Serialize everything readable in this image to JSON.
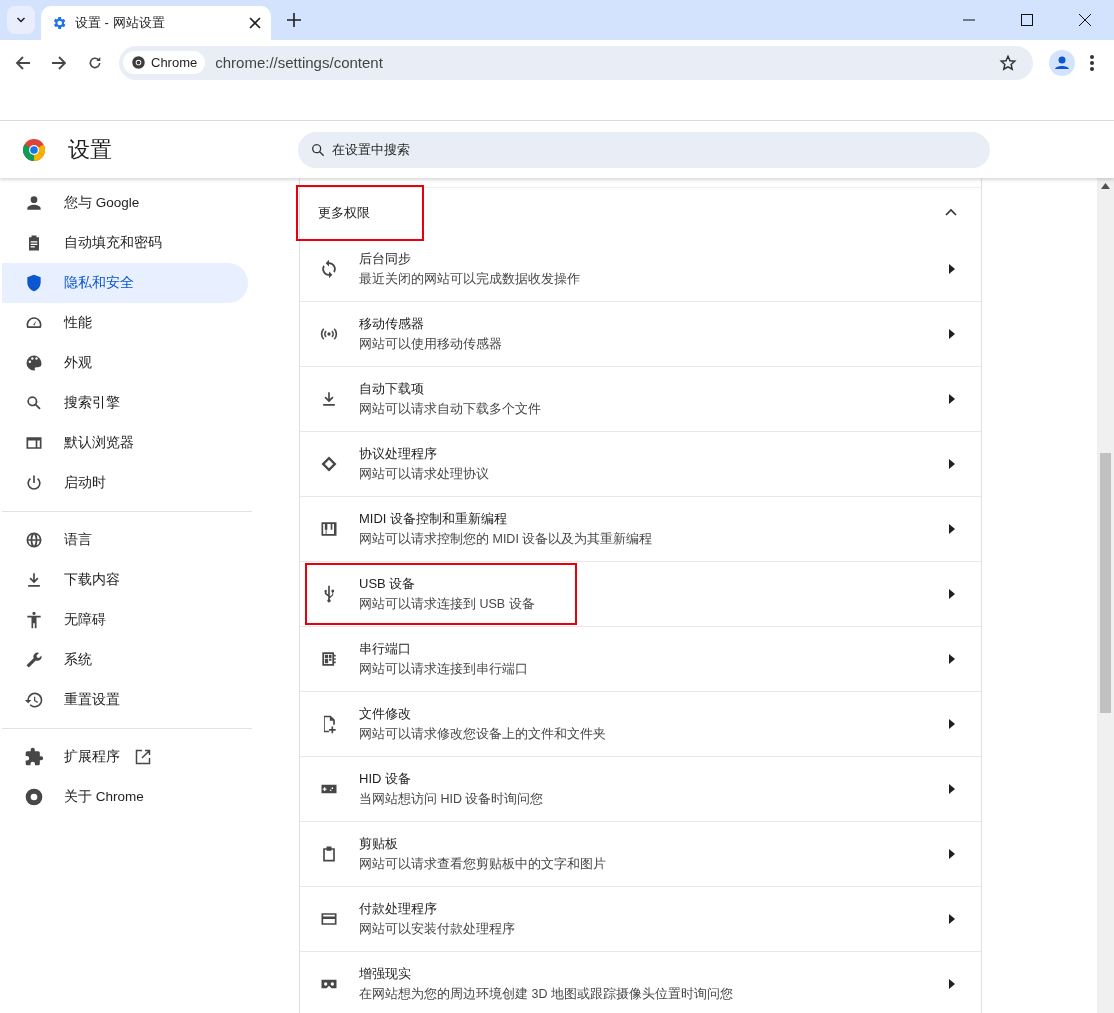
{
  "tab": {
    "title": "设置 - 网站设置",
    "selected": true
  },
  "address_bar": {
    "chip": "Chrome",
    "url": "chrome://settings/content"
  },
  "header": {
    "title": "设置",
    "search": {
      "placeholder": "在设置中搜索"
    }
  },
  "sidebar": {
    "groups": [
      [
        {
          "label": "您与 Google",
          "selected": false
        },
        {
          "label": "自动填充和密码",
          "selected": false
        },
        {
          "label": "隐私和安全",
          "selected": true
        },
        {
          "label": "性能",
          "selected": false
        },
        {
          "label": "外观",
          "selected": false
        },
        {
          "label": "搜索引擎",
          "selected": false
        },
        {
          "label": "默认浏览器",
          "selected": false
        },
        {
          "label": "启动时",
          "selected": false
        }
      ],
      [
        {
          "label": "语言",
          "selected": false
        },
        {
          "label": "下载内容",
          "selected": false
        },
        {
          "label": "无障碍",
          "selected": false
        },
        {
          "label": "系统",
          "selected": false
        },
        {
          "label": "重置设置",
          "selected": false
        }
      ],
      [
        {
          "label": "扩展程序",
          "selected": false,
          "external": true
        },
        {
          "label": "关于 Chrome",
          "selected": false,
          "external": false
        }
      ]
    ]
  },
  "section": {
    "title": "更多权限",
    "expanded": true,
    "highlighted": true
  },
  "permissions": [
    {
      "title": "后台同步",
      "description": "最近关闭的网站可以完成数据收发操作",
      "highlighted": false
    },
    {
      "title": "移动传感器",
      "description": "网站可以使用移动传感器",
      "highlighted": false
    },
    {
      "title": "自动下载项",
      "description": "网站可以请求自动下载多个文件",
      "highlighted": false
    },
    {
      "title": "协议处理程序",
      "description": "网站可以请求处理协议",
      "highlighted": false
    },
    {
      "title": "MIDI 设备控制和重新编程",
      "description": "网站可以请求控制您的 MIDI 设备以及为其重新编程",
      "highlighted": false
    },
    {
      "title": "USB 设备",
      "description": "网站可以请求连接到 USB 设备",
      "highlighted": true
    },
    {
      "title": "串行端口",
      "description": "网站可以请求连接到串行端口",
      "highlighted": false
    },
    {
      "title": "文件修改",
      "description": "网站可以请求修改您设备上的文件和文件夹",
      "highlighted": false
    },
    {
      "title": "HID 设备",
      "description": "当网站想访问 HID 设备时询问您",
      "highlighted": false
    },
    {
      "title": "剪贴板",
      "description": "网站可以请求查看您剪贴板中的文字和图片",
      "highlighted": false
    },
    {
      "title": "付款处理程序",
      "description": "网站可以安装付款处理程序",
      "highlighted": false
    },
    {
      "title": "增强现实",
      "description": "在网站想为您的周边环境创建 3D 地图或跟踪摄像头位置时询问您",
      "highlighted": false
    }
  ]
}
